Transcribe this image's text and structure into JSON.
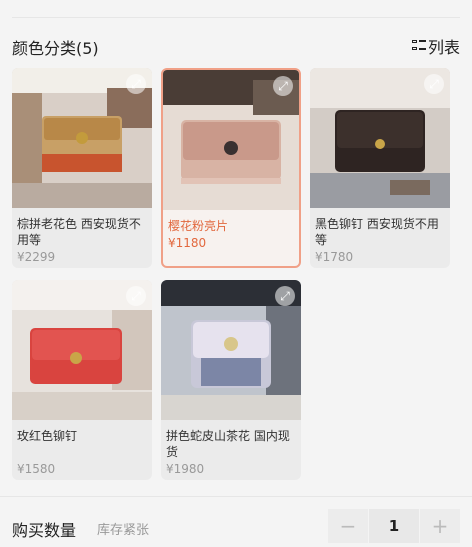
{
  "section": {
    "title": "颜色分类(5)",
    "list_toggle_label": "列表"
  },
  "products": [
    {
      "name": "棕拼老花色 西安现货不用等",
      "price": "¥2299",
      "selected": false
    },
    {
      "name": "樱花粉亮片",
      "price": "¥1180",
      "selected": true
    },
    {
      "name": "黑色铆钉 西安现货不用等",
      "price": "¥1780",
      "selected": false
    },
    {
      "name": "玫红色铆钉",
      "price": "¥1580",
      "selected": false
    },
    {
      "name": "拼色蛇皮山茶花 国内现货",
      "price": "¥1980",
      "selected": false
    }
  ],
  "purchase": {
    "label": "购买数量",
    "stock_note": "库存紧张",
    "quantity": "1",
    "minus": "−",
    "plus": "+"
  },
  "colors": {
    "accent": "#e2683e",
    "selected_border": "#f0a087"
  }
}
